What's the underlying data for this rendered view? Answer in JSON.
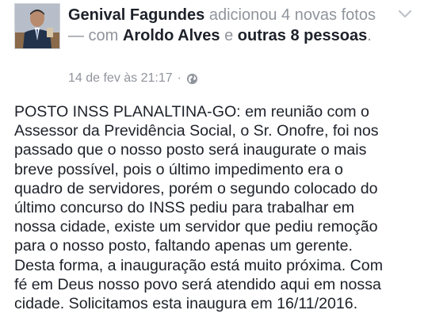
{
  "post": {
    "author": "Genival Fagundes",
    "action_1": "adicionou 4 novas fotos",
    "connector": "— com",
    "tagged_person": "Aroldo Alves",
    "and_word": "e",
    "others": "outras 8 pessoas",
    "period": ".",
    "timestamp": "14 de fev às 21:17",
    "separator": "·",
    "privacy_icon": "globe-icon",
    "menu_icon": "chevron-down-icon",
    "body_lines": [
      "POSTO INSS PLANALTINA-GO: em reunião com o",
      "Assessor da Previdência Social, o Sr. Onofre, foi nos",
      "passado que o nosso posto será inaugurate o mais",
      "breve possível, pois o último impedimento era o",
      "quadro de servidores, porém o segundo colocado do",
      "último concurso do INSS pediu para trabalhar em",
      "nossa cidade, existe um servidor que pediu remoção",
      "para o nosso posto, faltando apenas um gerente.",
      "Desta forma, a inauguração está muito próxima. Com",
      "fé em Deus nosso povo será atendido aqui em nossa",
      "cidade. Solicitamos esta inaugura em 16/11/2016."
    ]
  }
}
